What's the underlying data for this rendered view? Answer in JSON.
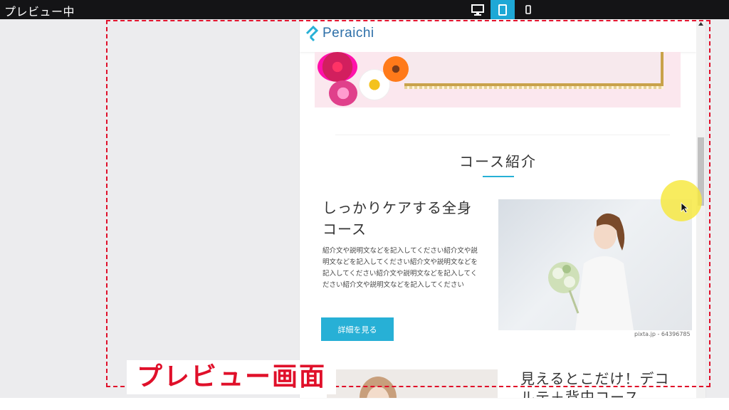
{
  "topbar": {
    "title": "プレビュー中",
    "devices": [
      {
        "name": "desktop",
        "icon": "desktop-icon",
        "active": false
      },
      {
        "name": "tablet",
        "icon": "tablet-icon",
        "active": true
      },
      {
        "name": "mobile",
        "icon": "mobile-icon",
        "active": false
      }
    ]
  },
  "site": {
    "logo_text": "Peraichi",
    "section_title": "コース紹介",
    "courses": [
      {
        "title": "しっかりケアする全身コース",
        "description": "紹介文や説明文などを記入してください紹介文や説明文などを記入してください紹介文や説明文などを記入してください紹介文や説明文などを記入してください紹介文や説明文などを記入してください",
        "button": "詳細を見る",
        "photo_credit": "pixta.jp - 64396785"
      },
      {
        "title": "見えるとこだけ！デコルテ＋背中コース"
      }
    ]
  },
  "annotation": "プレビュー画面",
  "colors": {
    "accent": "#27b0d6",
    "topbar": "#141416",
    "annotation_red": "#e0102a",
    "logo_blue": "#2d6fa8"
  }
}
